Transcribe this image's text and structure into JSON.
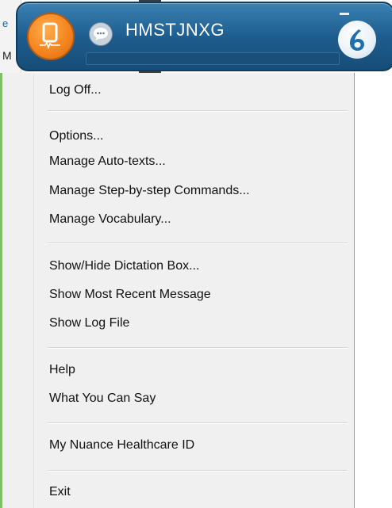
{
  "background": {
    "left_fragment_top": "e",
    "left_fragment_bottom": "M"
  },
  "dragon_bar": {
    "username": "HMSTJNXG",
    "icons": {
      "microphone": "microphone-icon",
      "message": "message-bubble-icon",
      "minimize": "minimize-icon",
      "logo": "dragon-flame-logo"
    },
    "colors": {
      "bar": "#1e5d8f",
      "mic": "#f5861f"
    }
  },
  "menu": {
    "log_off": "Log Off...",
    "options": "Options...",
    "manage_auto_texts": "Manage Auto-texts...",
    "manage_step_commands": "Manage Step-by-step Commands...",
    "manage_vocabulary": "Manage Vocabulary...",
    "show_hide_dictation": "Show/Hide Dictation Box...",
    "show_recent_message": "Show Most Recent Message",
    "show_log_file": "Show Log File",
    "help": "Help",
    "what_you_can_say": "What You Can Say",
    "nuance_id": "My Nuance Healthcare ID",
    "exit": "Exit"
  }
}
